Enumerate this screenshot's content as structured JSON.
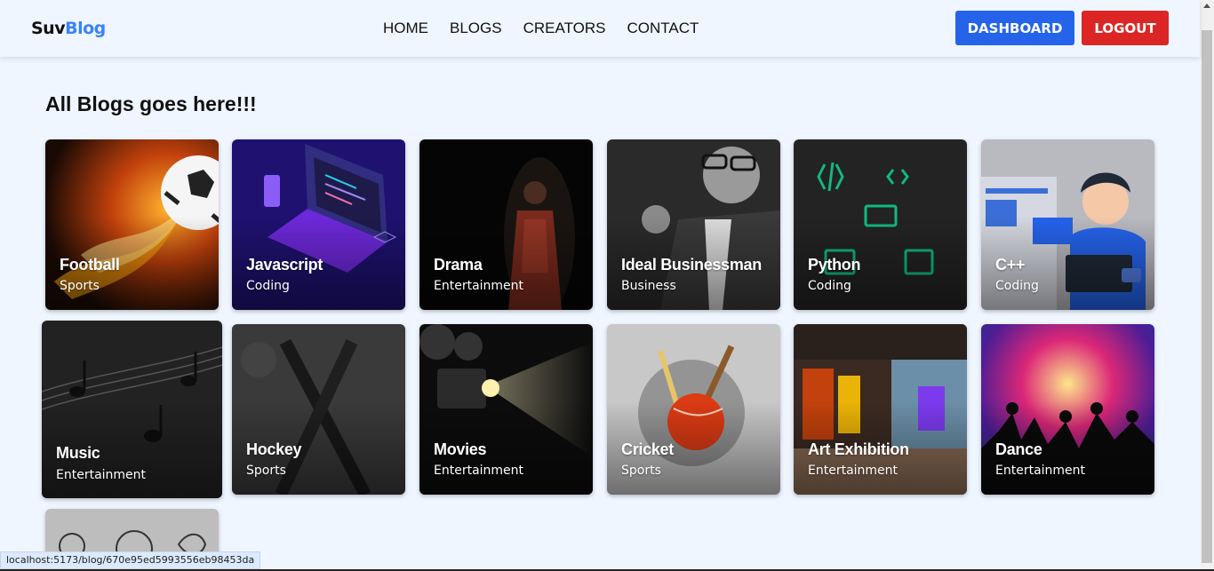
{
  "brand": {
    "part1": "Suv",
    "part2": "Blog",
    "accent": "#3b82f6"
  },
  "nav": {
    "links": [
      "HOME",
      "BLOGS",
      "CREATORS",
      "CONTACT"
    ]
  },
  "actions": {
    "dashboard": "DASHBOARD",
    "logout": "LOGOUT"
  },
  "page": {
    "heading": "All Blogs goes here!!!"
  },
  "blogs": [
    {
      "title": "Football",
      "category": "Sports",
      "icon": "football-image"
    },
    {
      "title": "Javascript",
      "category": "Coding",
      "icon": "laptop-image"
    },
    {
      "title": "Drama",
      "category": "Entertainment",
      "icon": "performer-image"
    },
    {
      "title": "Ideal Businessman",
      "category": "Business",
      "icon": "businessman-image"
    },
    {
      "title": "Python",
      "category": "Coding",
      "icon": "code-icons-image"
    },
    {
      "title": "C++",
      "category": "Coding",
      "icon": "blogger-image"
    },
    {
      "title": "Music",
      "category": "Entertainment",
      "icon": "music-notes-image"
    },
    {
      "title": "Hockey",
      "category": "Sports",
      "icon": "hockey-sticks-image"
    },
    {
      "title": "Movies",
      "category": "Entertainment",
      "icon": "projector-image"
    },
    {
      "title": "Cricket",
      "category": "Sports",
      "icon": "cricket-ball-image"
    },
    {
      "title": "Art Exhibition",
      "category": "Entertainment",
      "icon": "gallery-image"
    },
    {
      "title": "Dance",
      "category": "Entertainment",
      "icon": "dancers-image"
    }
  ],
  "status_url": "localhost:5173/blog/670e95ed5993556eb98453da"
}
